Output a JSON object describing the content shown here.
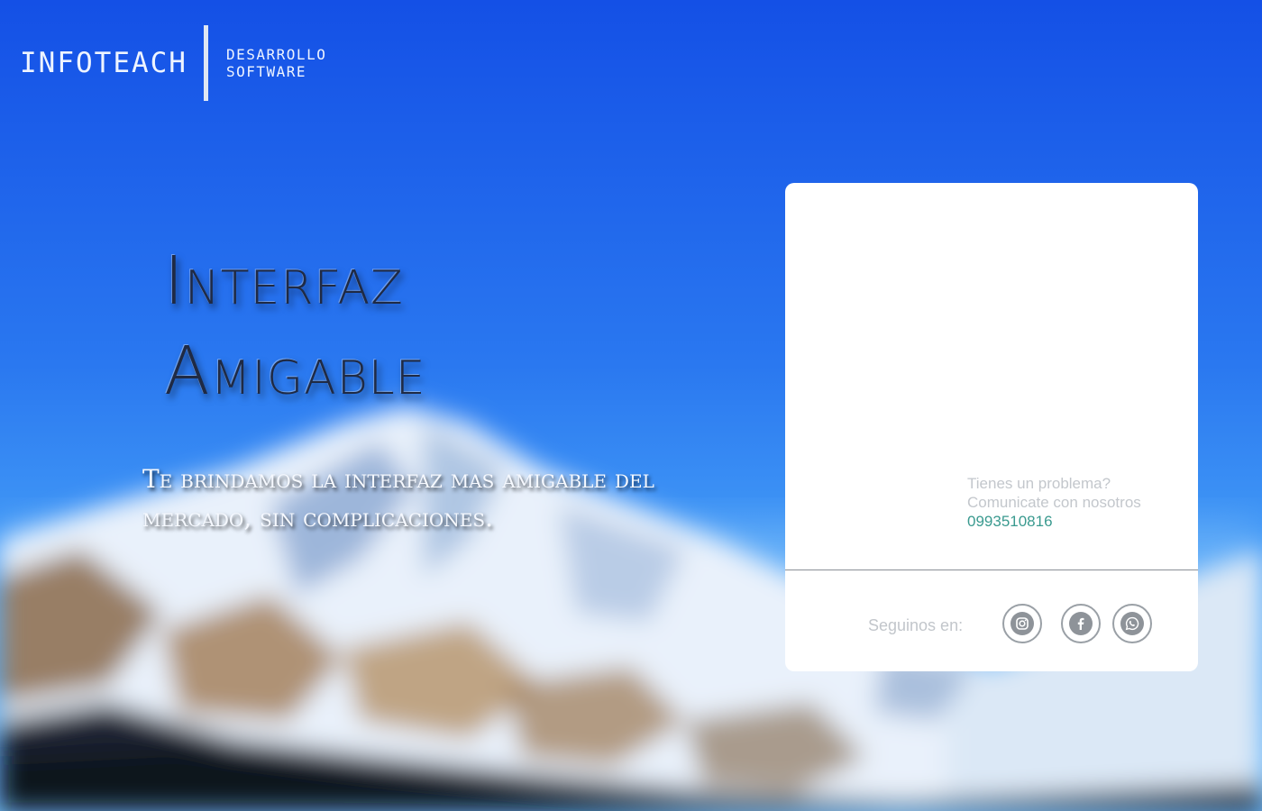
{
  "header": {
    "brand": "INFOTEACH",
    "tagline_line1": "DESARROLLO",
    "tagline_line2": "SOFTWARE"
  },
  "hero": {
    "title_line1": "Interfaz",
    "title_line2": "Amigable",
    "subtitle": "Te brindamos la interfaz mas amigable del mercado, sin complicaciones."
  },
  "contact": {
    "line1": "Tienes un problema?",
    "line2": "Comunicate con nosotros",
    "phone": "0993510816"
  },
  "social": {
    "label": "Seguinos en:",
    "icons": [
      "instagram-icon",
      "facebook-icon",
      "whatsapp-icon"
    ]
  },
  "colors": {
    "sky_top": "#1450e6",
    "sky_bottom": "#3f9cf7",
    "card_bg": "#ffffff",
    "phone": "#3a9a8f",
    "muted_text": "#c3c7cc",
    "icon": "#8e9399"
  }
}
